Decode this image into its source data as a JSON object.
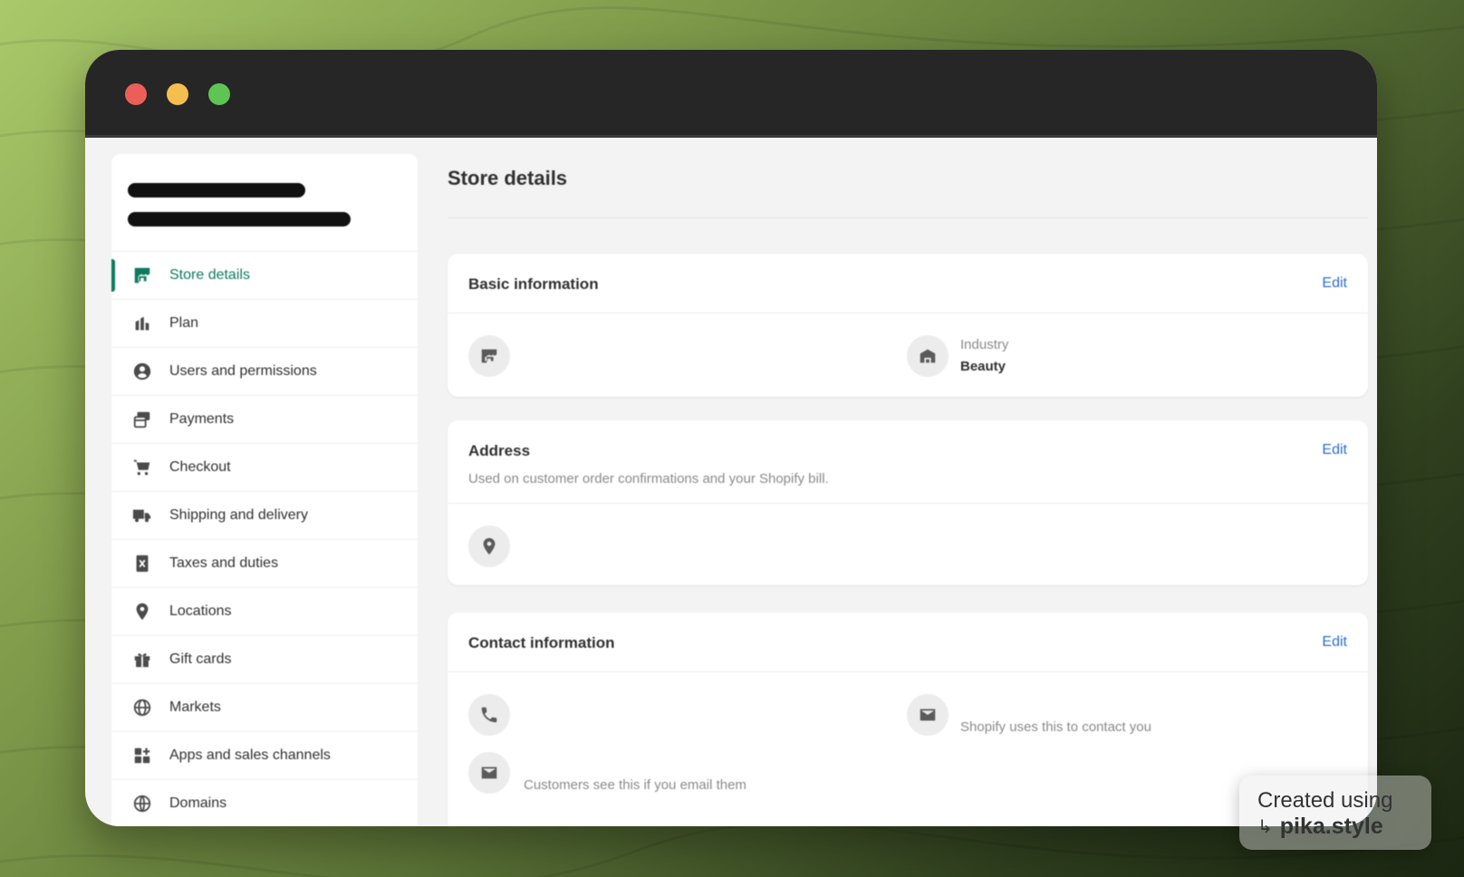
{
  "sidebar": {
    "items": [
      {
        "label": "Store details",
        "icon": "store-icon",
        "active": true
      },
      {
        "label": "Plan",
        "icon": "plan-icon",
        "active": false
      },
      {
        "label": "Users and permissions",
        "icon": "user-icon",
        "active": false
      },
      {
        "label": "Payments",
        "icon": "payments-icon",
        "active": false
      },
      {
        "label": "Checkout",
        "icon": "cart-icon",
        "active": false
      },
      {
        "label": "Shipping and delivery",
        "icon": "truck-icon",
        "active": false
      },
      {
        "label": "Taxes and duties",
        "icon": "taxes-icon",
        "active": false
      },
      {
        "label": "Locations",
        "icon": "location-icon",
        "active": false
      },
      {
        "label": "Gift cards",
        "icon": "gift-icon",
        "active": false
      },
      {
        "label": "Markets",
        "icon": "globe-icon",
        "active": false
      },
      {
        "label": "Apps and sales channels",
        "icon": "apps-icon",
        "active": false
      },
      {
        "label": "Domains",
        "icon": "domains-icon",
        "active": false
      }
    ]
  },
  "main": {
    "title": "Store details",
    "basic": {
      "title": "Basic information",
      "edit": "Edit",
      "industry_label": "Industry",
      "industry_value": "Beauty"
    },
    "address": {
      "title": "Address",
      "edit": "Edit",
      "subtitle": "Used on customer order confirmations and your Shopify bill."
    },
    "contact": {
      "title": "Contact information",
      "edit": "Edit",
      "email_hint_shopify": "Shopify uses this to contact you",
      "email_hint_customers": "Customers see this if you email them"
    }
  },
  "watermark": {
    "line1": "Created using",
    "arrow": "↳",
    "line2": "pika.style"
  },
  "colors": {
    "accent": "#0d7a5f",
    "link": "#2c6ecb",
    "titlebar": "#262626"
  }
}
